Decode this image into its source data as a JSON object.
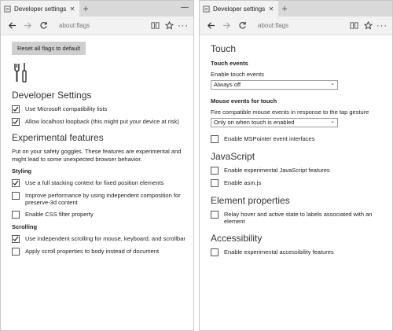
{
  "left": {
    "tab": {
      "title": "Developer settings",
      "close": "✕"
    },
    "new_tab": "+",
    "window_control": "—",
    "url": "about:flags",
    "reset_button": "Reset all flags to default",
    "dev_settings_heading": "Developer Settings",
    "dev_options": [
      {
        "label": "Use Microsoft compatibility lists",
        "checked": true
      },
      {
        "label": "Allow localhost loopback (this might put your device at risk)",
        "checked": true
      }
    ],
    "experimental_heading": "Experimental features",
    "experimental_desc": "Put on your safety goggles. These features are experimental and might lead to some unexpected browser behavior.",
    "styling_heading": "Styling",
    "styling_options": [
      {
        "label": "Use a full stacking context for fixed position elements",
        "checked": true
      },
      {
        "label": "Improve performance by using independent composition for preserve-3d content",
        "checked": false
      },
      {
        "label": "Enable CSS filter property",
        "checked": false
      }
    ],
    "scrolling_heading": "Scrolling",
    "scrolling_options": [
      {
        "label": "Use independent scrolling for mouse, keyboard, and scrollbar",
        "checked": true
      },
      {
        "label": "Apply scroll properties to body instead of document",
        "checked": false
      }
    ]
  },
  "right": {
    "tab": {
      "title": "Developer settings",
      "close": "✕"
    },
    "new_tab": "+",
    "url": "about:flags",
    "touch_heading": "Touch",
    "touch_events_heading": "Touch events",
    "enable_touch_label": "Enable touch events",
    "enable_touch_value": "Always off",
    "mouse_events_heading": "Mouse events for touch",
    "fire_mouse_label": "Fire compatible mouse events in response to the tap gesture",
    "fire_mouse_value": "Only on when touch is enabled",
    "mspointer_option": {
      "label": "Enable MSPointer event interfaces",
      "checked": false
    },
    "javascript_heading": "JavaScript",
    "javascript_options": [
      {
        "label": "Enable experimental JavaScript features",
        "checked": false
      },
      {
        "label": "Enable asm.js",
        "checked": false
      }
    ],
    "element_heading": "Element properties",
    "element_option": {
      "label": "Relay hover and active state to labels associated with an element",
      "checked": false
    },
    "accessibility_heading": "Accessibility",
    "accessibility_option": {
      "label": "Enable experimental accessibility features",
      "checked": false
    }
  },
  "icons": {
    "tab": "settings-page-icon",
    "back": "arrow-left-icon",
    "forward": "arrow-right-icon",
    "refresh": "refresh-icon",
    "reading": "reading-view-icon",
    "favorite": "star-icon",
    "more": "more-icon"
  },
  "colors": {
    "tab_strip": "#d9d9d9",
    "active_tab": "#f2f2f2",
    "reset_button": "#cfcfcf"
  }
}
